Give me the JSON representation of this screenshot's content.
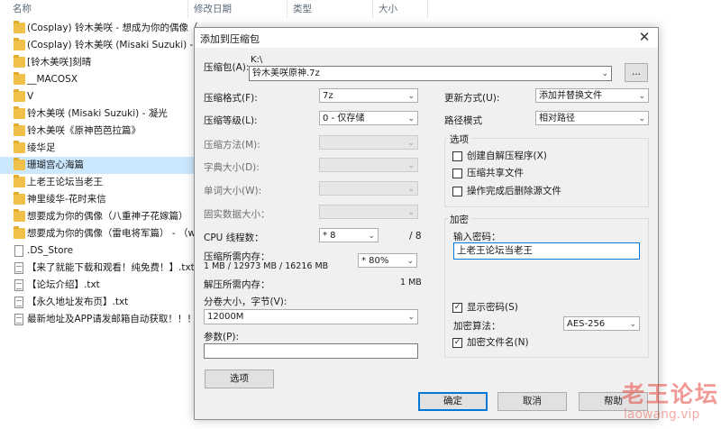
{
  "explorer": {
    "columns": [
      "名称",
      "修改日期",
      "类型",
      "大小"
    ],
    "files": [
      {
        "name": "(Cosplay) 铃木美咲 - 想成为你的偶像（...",
        "kind": "folder",
        "selected": false
      },
      {
        "name": "(Cosplay) 铃木美咲 (Misaki Suzuki) - 想...",
        "kind": "folder",
        "selected": false
      },
      {
        "name": "[铃木美咲]刻晴",
        "kind": "folder",
        "selected": false
      },
      {
        "name": "__MACOSX",
        "kind": "folder",
        "selected": false
      },
      {
        "name": "V",
        "kind": "folder",
        "selected": false
      },
      {
        "name": "铃木美咲 (Misaki Suzuki) - 凝光",
        "kind": "folder",
        "selected": false
      },
      {
        "name": "铃木美咲《原神芭芭拉篇》",
        "kind": "folder",
        "selected": false
      },
      {
        "name": "绫华足",
        "kind": "folder",
        "selected": false
      },
      {
        "name": "珊瑚宫心海篇",
        "kind": "folder",
        "selected": true
      },
      {
        "name": "上老王论坛当老王",
        "kind": "folder",
        "selected": false
      },
      {
        "name": "神里绫华-花时来信",
        "kind": "folder",
        "selected": false
      },
      {
        "name": "想要成为你的偶像（八重神子花嫁篇）",
        "kind": "folder",
        "selected": false
      },
      {
        "name": "想要成为你的偶像（雷电将军篇） - （w ...",
        "kind": "folder",
        "selected": false
      },
      {
        "name": ".DS_Store",
        "kind": "doc",
        "selected": false
      },
      {
        "name": "【来了就能下载和观看！纯免费！】.txt",
        "kind": "txt",
        "selected": false
      },
      {
        "name": "【论坛介绍】.txt",
        "kind": "txt",
        "selected": false
      },
      {
        "name": "【永久地址发布页】.txt",
        "kind": "txt",
        "selected": false
      },
      {
        "name": "最新地址及APP请发邮箱自动获取！！！...",
        "kind": "txt",
        "selected": false
      }
    ]
  },
  "dialog": {
    "title": "添加到压缩包",
    "archive_label": "压缩包(A):",
    "archive_dir": "K:\\",
    "archive_name": "铃木美咲原神.7z",
    "browse_label": "...",
    "format_label": "压缩格式(F):",
    "format_value": "7z",
    "level_label": "压缩等级(L):",
    "level_value": "0 - 仅存储",
    "method_label": "压缩方法(M):",
    "dict_label": "字典大小(D):",
    "word_label": "单词大小(W):",
    "solid_label": "固实数据大小：",
    "threads_label": "CPU 线程数：",
    "threads_value": "* 8",
    "threads_total": "/ 8",
    "mem_comp_label": "压缩所需内存：",
    "mem_comp_detail": "1 MB / 12973 MB / 16216 MB",
    "mem_percent": "* 80%",
    "mem_decomp_label": "解压所需内存：",
    "mem_decomp_value": "1 MB",
    "split_label": "分卷大小，字节(V):",
    "split_value": "12000M",
    "params_label": "参数(P):",
    "params_value": "",
    "options_button": "选项",
    "update_label": "更新方式(U):",
    "update_value": "添加并替换文件",
    "path_label": "路径模式",
    "path_value": "相对路径",
    "options_group": {
      "title": "选项",
      "sfx": {
        "label": "创建自解压程序(X)",
        "checked": false
      },
      "shared": {
        "label": "压缩共享文件",
        "checked": false
      },
      "delete_after": {
        "label": "操作完成后删除源文件",
        "checked": false
      }
    },
    "encryption_group": {
      "title": "加密",
      "password_label": "输入密码：",
      "password_value": "上老王论坛当老王",
      "show_password": {
        "label": "显示密码(S)",
        "checked": true
      },
      "method_label": "加密算法：",
      "method_value": "AES-256",
      "encrypt_names": {
        "label": "加密文件名(N)",
        "checked": true
      }
    },
    "ok_label": "确定",
    "cancel_label": "取消",
    "help_label": "帮助"
  },
  "watermark": {
    "line1": "老王论坛",
    "line2": "laowang.vip"
  },
  "colors": {
    "accent": "#0078d7",
    "selection": "#cce8ff",
    "dialog_bg": "#f0f0f0",
    "watermark": "#e6463c"
  }
}
